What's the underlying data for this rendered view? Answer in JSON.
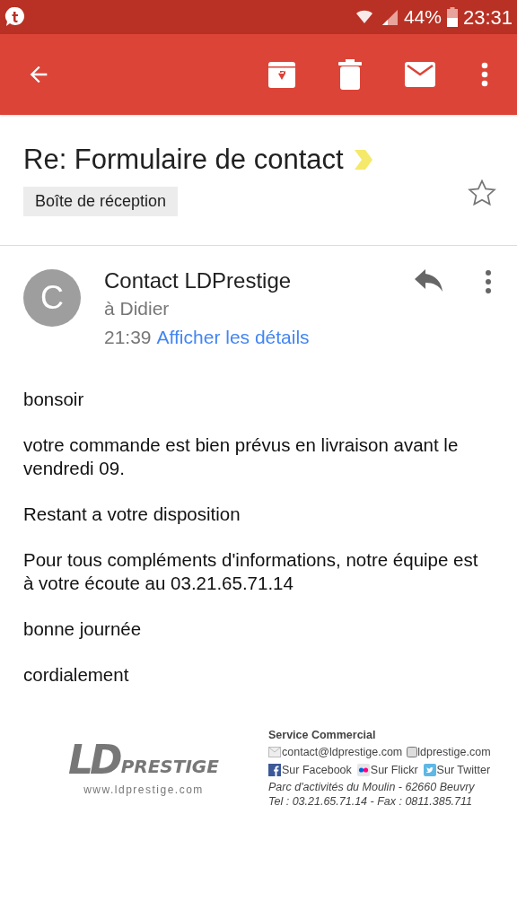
{
  "status_bar": {
    "battery": "44%",
    "time": "23:31"
  },
  "subject": {
    "title": "Re: Formulaire de contact",
    "important": true,
    "label": "Boîte de réception",
    "starred": false
  },
  "message": {
    "avatar_letter": "C",
    "sender": "Contact LDPrestige",
    "recipient": "à Didier",
    "time": "21:39",
    "details_link": "Afficher les détails"
  },
  "body": [
    "bonsoir",
    "votre commande est bien prévus en livraison avant le vendredi 09.",
    "Restant a votre disposition",
    "Pour tous compléments d'informations, notre équipe est à votre écoute au 03.21.65.71.14",
    "bonne journée",
    "cordialement"
  ],
  "signature": {
    "logo": {
      "initials": "LD",
      "wordmark": "PRESTIGE",
      "url": "www.ldprestige.com"
    },
    "heading": "Service Commercial",
    "email": "contact@ldprestige.com",
    "website": "ldprestige.com",
    "social": [
      {
        "kind": "facebook",
        "label": "Sur Facebook"
      },
      {
        "kind": "flickr",
        "label": "Sur Flickr"
      },
      {
        "kind": "twitter",
        "label": "Sur Twitter"
      }
    ],
    "address": "Parc d'activités du Moulin -  62660 Beuvry",
    "phone": "Tel : 03.21.65.71.14 - Fax : 0811.385.711"
  }
}
